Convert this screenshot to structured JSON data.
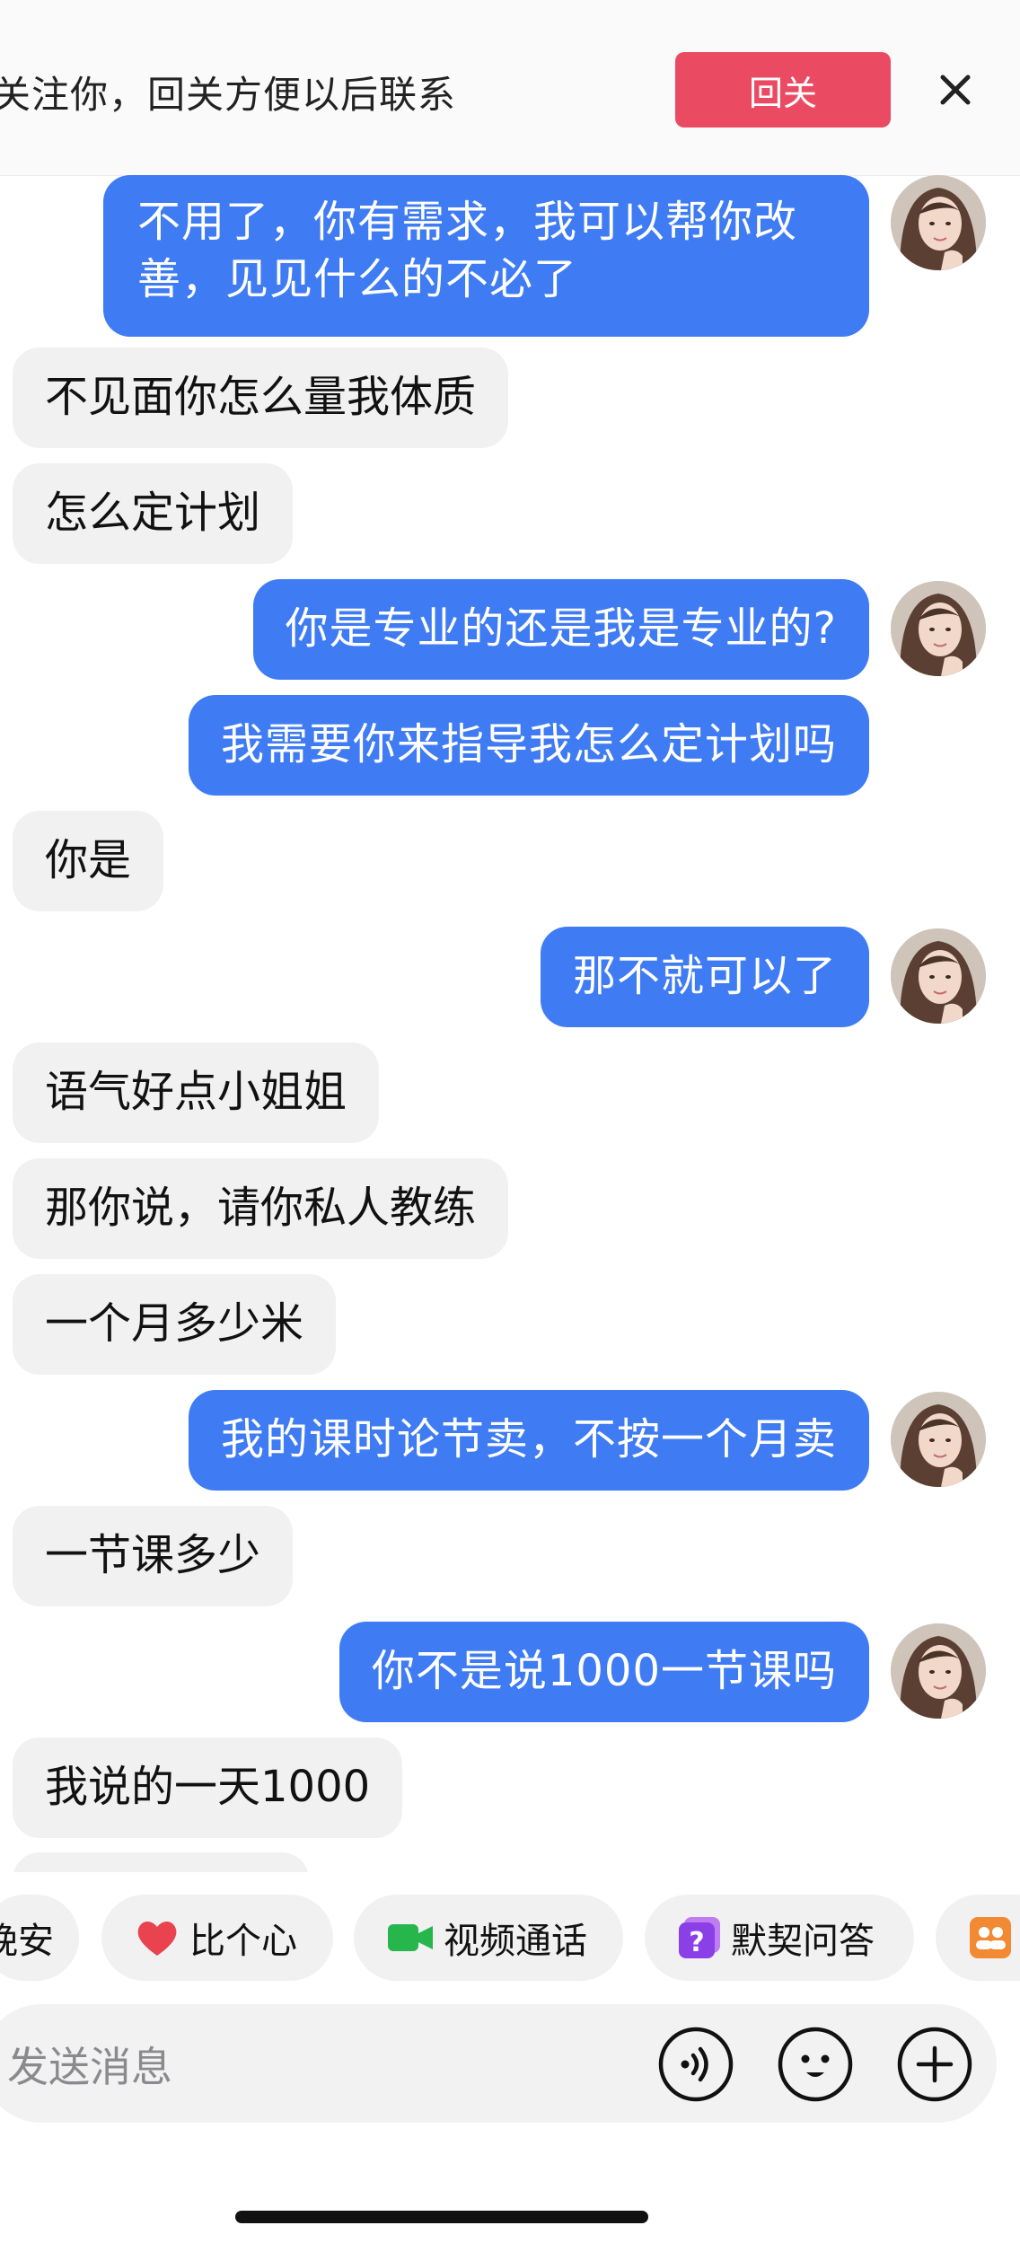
{
  "banner": {
    "text": "关注你，回关方便以后联系",
    "follow_label": "回关",
    "close_icon": "close-icon"
  },
  "messages": [
    {
      "side": "out",
      "text": "不用了，你有需求，我可以帮你改善，见见什么的不必了"
    },
    {
      "side": "in",
      "text": "不见面你怎么量我体质"
    },
    {
      "side": "in",
      "text": "怎么定计划"
    },
    {
      "side": "out",
      "text": "你是专业的还是我是专业的?"
    },
    {
      "side": "out",
      "text": "我需要你来指导我怎么定计划吗"
    },
    {
      "side": "in",
      "text": "你是"
    },
    {
      "side": "out",
      "text": "那不就可以了"
    },
    {
      "side": "in",
      "text": "语气好点小姐姐"
    },
    {
      "side": "in",
      "text": "那你说，请你私人教练"
    },
    {
      "side": "in",
      "text": "一个月多少米"
    },
    {
      "side": "out",
      "text": "我的课时论节卖，不按一个月卖"
    },
    {
      "side": "in",
      "text": "一节课多少"
    },
    {
      "side": "out",
      "text": "你不是说1000一节课吗"
    },
    {
      "side": "in",
      "text": "我说的一天1000"
    }
  ],
  "quick_actions": [
    {
      "label": "晚安",
      "icon": "none"
    },
    {
      "label": "比个心",
      "icon": "heart-icon"
    },
    {
      "label": "视频通话",
      "icon": "video-camera-icon"
    },
    {
      "label": "默契问答",
      "icon": "question-card-icon"
    },
    {
      "label": "",
      "icon": "group-icon"
    }
  ],
  "input": {
    "placeholder": "发送消息",
    "voice_icon": "voice-icon",
    "emoji_icon": "emoji-icon",
    "add_icon": "plus-icon"
  },
  "colors": {
    "outgoing_bubble": "#3f7bf3",
    "incoming_bubble": "#f1f1f2",
    "follow_button": "#ea4b62"
  }
}
